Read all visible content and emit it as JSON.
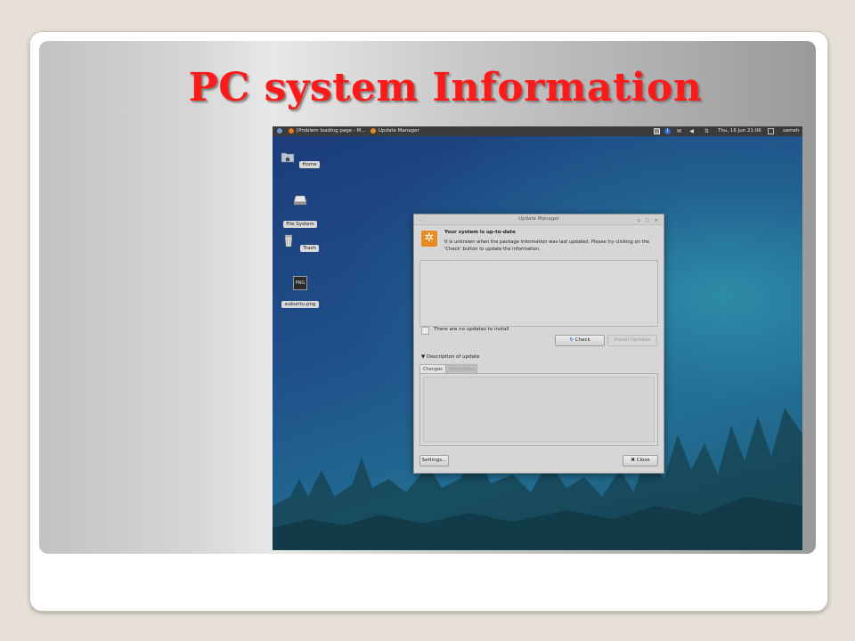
{
  "slide": {
    "title": "PC system Information"
  },
  "taskbar": {
    "items": [
      {
        "label": "[Problem loading page - M..."
      },
      {
        "label": "Update Manager"
      }
    ],
    "clock": "Thu, 16 Jun  21:06",
    "user": "sameh"
  },
  "desktop": {
    "icons": [
      {
        "label": "Home",
        "icon": "home-folder-icon"
      },
      {
        "label": "File System",
        "icon": "drive-icon"
      },
      {
        "label": "Trash",
        "icon": "trash-icon"
      },
      {
        "label": "xubuntu.png",
        "icon": "image-file-icon",
        "badge": "PNG"
      }
    ]
  },
  "dialog": {
    "title": "Update Manager",
    "heading": "Your system is up-to-date",
    "message": "It is unknown when the package information was last updated. Please try clicking on the 'Check' button to update the information.",
    "no_updates_label": "There are no updates to install",
    "check_button": "Check",
    "install_button": "Install Updates",
    "description_label": "Description of update",
    "tabs": [
      "Changes",
      "Description"
    ],
    "settings_button": "Settings...",
    "close_button": "Close"
  },
  "colors": {
    "title": "#ff1a1a",
    "dialog_bg": "#d6d6d6",
    "taskbar_bg": "#3b3b3b",
    "desktop_blue": "#1f4f8a",
    "info_icon": "#e68a24"
  }
}
